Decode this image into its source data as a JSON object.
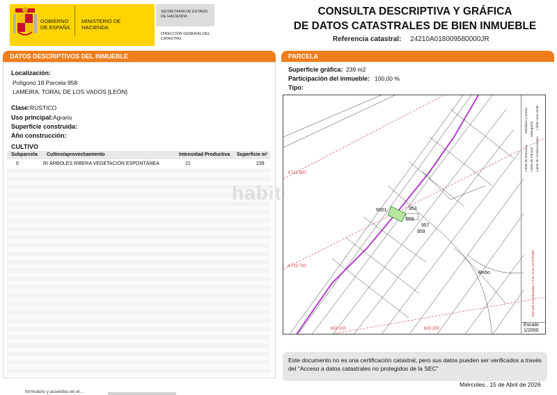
{
  "header": {
    "gobierno": "GOBIERNO DE ESPAÑA",
    "ministerio": "MINISTERIO DE HACIENDA",
    "secretaria": "SECRETARÍA DE ESTADO DE HACIENDA",
    "direccion": "DIRECCIÓN GENERAL DEL CATASTRO",
    "title_line1": "CONSULTA DESCRIPTIVA Y GRÁFICA",
    "title_line2": "DE DATOS CATASTRALES DE BIEN INMUEBLE",
    "ref_label": "Referencia catastral:",
    "ref_value": "24210A018009580000JR",
    "brand_color": "#ffd400",
    "accent_color": "#f07d1b"
  },
  "left": {
    "section_title": "DATOS DESCRIPTIVOS DEL INMUEBLE",
    "localizacion_label": "Localización:",
    "localizacion_line1": "Polígono 18 Parcela 958",
    "localizacion_line2": "LAMEIRA. TORAL DE LOS VADOS [LEÓN]",
    "clase_label": "Clase:",
    "clase_value": "RÚSTICO",
    "uso_label": "Uso principal:",
    "uso_value": "Agrario",
    "superficie_label": "Superficie construida:",
    "anio_label": "Año construcción:",
    "cultivo_title": "CULTIVO",
    "cultivo_headers": {
      "subparcela": "Subparcela",
      "cultivo": "Cultivo/aprovechamiento",
      "intensidad": "Intensidad Productiva",
      "superficie": "Superficie m²"
    },
    "cultivo_row": {
      "subparcela": "0",
      "cultivo": "RI ÁRBOLES RIBERA VEGETACIÓN ESPONTÁNEA",
      "intensidad": "21",
      "superficie": "239"
    }
  },
  "right": {
    "section_title": "PARCELA",
    "sup_grafica_label": "Superficie gráfica:",
    "sup_grafica_value": "239 m2",
    "participacion_label": "Participación del inmueble:",
    "participacion_value": "100,00 %",
    "tipo_label": "Tipo:"
  },
  "map": {
    "coord_y1": "4 712 800",
    "coord_y2": "4 712 700",
    "coord_x1": "603 100",
    "coord_x2": "603 200",
    "plots": [
      "9001",
      "958",
      "953",
      "957",
      "959",
      "Rebo"
    ],
    "legend": [
      "Límite de Manzana",
      "Límite de Parcela",
      "Límite de Construcciones",
      "Mobiliario y aceras",
      "Límite zona verde",
      "Hidrografía"
    ],
    "crs": "603.300 Coordenadas U.T.M. Huso 29 ETRS89",
    "scale_label": "Escala:",
    "scale_value": "1/2000",
    "watermark": "habitaclia"
  },
  "footer": {
    "note": "Este documento no es una certificación catastral, pero sus datos pueden ser verificados a través del \"Acceso a datos catastrales no protegidos de la SEC\"",
    "date": "Miércoles , 15 de Abril de 2026",
    "bottom_text": "formulario y acuerdos en el..."
  }
}
